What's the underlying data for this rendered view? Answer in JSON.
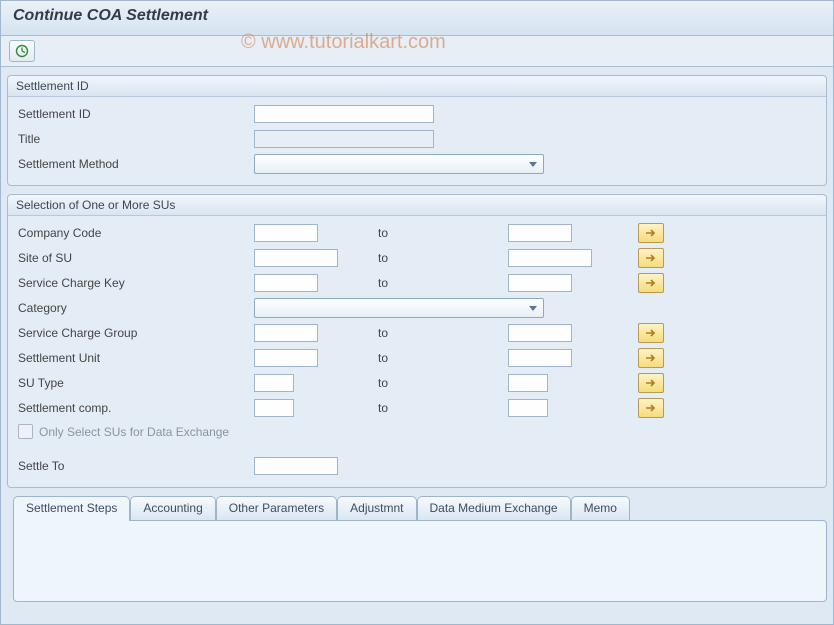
{
  "window": {
    "title": "Continue COA Settlement",
    "watermark": "©  www.tutorialkart.com"
  },
  "group_settlement_id": {
    "title": "Settlement ID",
    "fields": {
      "id_label": "Settlement ID",
      "title_label": "Title",
      "method_label": "Settlement Method"
    }
  },
  "group_su": {
    "title": "Selection of One or More SUs",
    "to_label": "to",
    "fields": {
      "company_code": "Company Code",
      "site_of_su": "Site of SU",
      "service_charge_key": "Service Charge Key",
      "category": "Category",
      "service_charge_group": "Service Charge Group",
      "settlement_unit": "Settlement Unit",
      "su_type": "SU Type",
      "settlement_comp": "Settlement comp.",
      "only_select_label": "Only Select SUs for Data Exchange",
      "settle_to": "Settle To"
    }
  },
  "tabs": {
    "settlement_steps": "Settlement Steps",
    "accounting": "Accounting",
    "other_parameters": "Other Parameters",
    "adjustmnt": "Adjustmnt",
    "data_medium_exchange": "Data Medium Exchange",
    "memo": "Memo"
  }
}
